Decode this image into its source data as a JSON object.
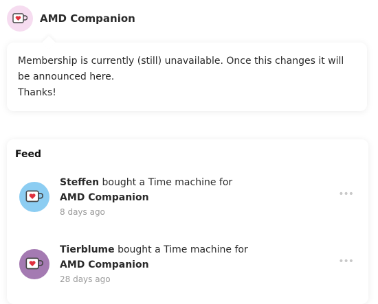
{
  "header": {
    "title": "AMD Companion",
    "icon": "mug-heart-icon"
  },
  "notice": {
    "lines": [
      "Membership is currently (still) unavailable. Once this changes it will",
      "be announced here.",
      "Thanks!"
    ]
  },
  "feed": {
    "heading": "Feed",
    "items": [
      {
        "name": "Steffen",
        "action": " bought a Time machine for",
        "target": "AMD Companion",
        "time": "8 days ago",
        "avatar_color": "#8ccdf2"
      },
      {
        "name": "Tierblume",
        "action": " bought a Time machine for",
        "target": "AMD Companion",
        "time": "28 days ago",
        "avatar_color": "#a47ab2"
      }
    ]
  }
}
